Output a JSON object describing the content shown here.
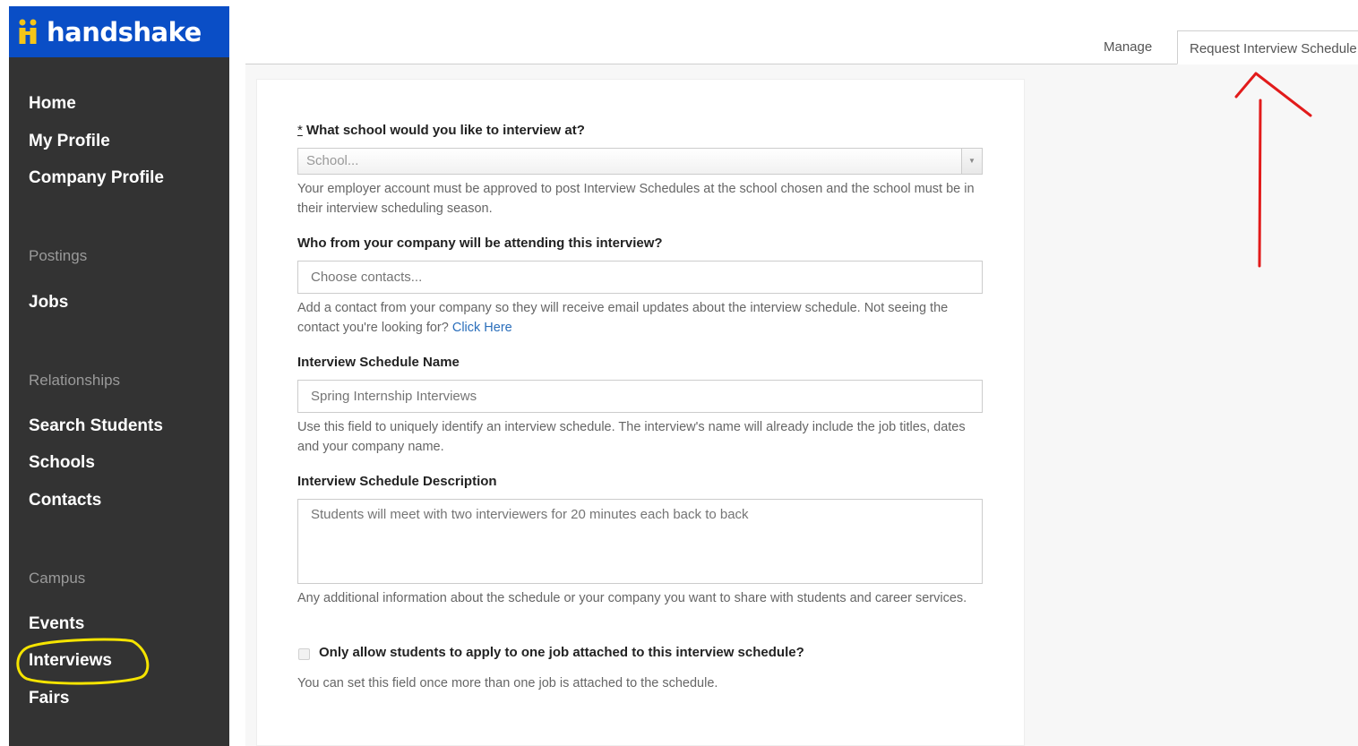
{
  "brand": {
    "name": "handshake",
    "logo_color": "#0a4ec6",
    "mark_color": "#f5c518"
  },
  "sidebar": {
    "items": [
      {
        "label": "Home"
      },
      {
        "label": "My Profile"
      },
      {
        "label": "Company Profile"
      },
      {
        "section": "Postings"
      },
      {
        "label": "Jobs"
      },
      {
        "section": "Relationships"
      },
      {
        "label": "Search Students"
      },
      {
        "label": "Schools"
      },
      {
        "label": "Contacts"
      },
      {
        "section": "Campus"
      },
      {
        "label": "Events"
      },
      {
        "label": "Interviews",
        "highlighted": true
      },
      {
        "label": "Fairs"
      }
    ]
  },
  "tabs": {
    "manage": "Manage",
    "request": "Request Interview Schedule"
  },
  "form": {
    "required_mark": "*",
    "school": {
      "label": "What school would you like to interview at?",
      "placeholder": "School...",
      "help": "Your employer account must be approved to post Interview Schedules at the school chosen and the school must be in their interview scheduling season."
    },
    "contacts": {
      "label": "Who from your company will be attending this interview?",
      "placeholder": "Choose contacts...",
      "help": "Add a contact from your company so they will receive email updates about the interview schedule. Not seeing the contact you're looking for?",
      "help_link": "Click Here"
    },
    "name": {
      "label": "Interview Schedule Name",
      "placeholder": "Spring Internship Interviews",
      "help": "Use this field to uniquely identify an interview schedule. The interview's name will already include the job titles, dates and your company name."
    },
    "description": {
      "label": "Interview Schedule Description",
      "placeholder": "Students will meet with two interviewers for 20 minutes each back to back",
      "help": "Any additional information about the schedule or your company you want to share with students and career services."
    },
    "one_job": {
      "label": "Only allow students to apply to one job attached to this interview schedule?",
      "checked": false,
      "help": "You can set this field once more than one job is attached to the schedule."
    }
  },
  "annotations": {
    "arrow_color": "#e21b1b",
    "circle_color": "#f5e400"
  }
}
